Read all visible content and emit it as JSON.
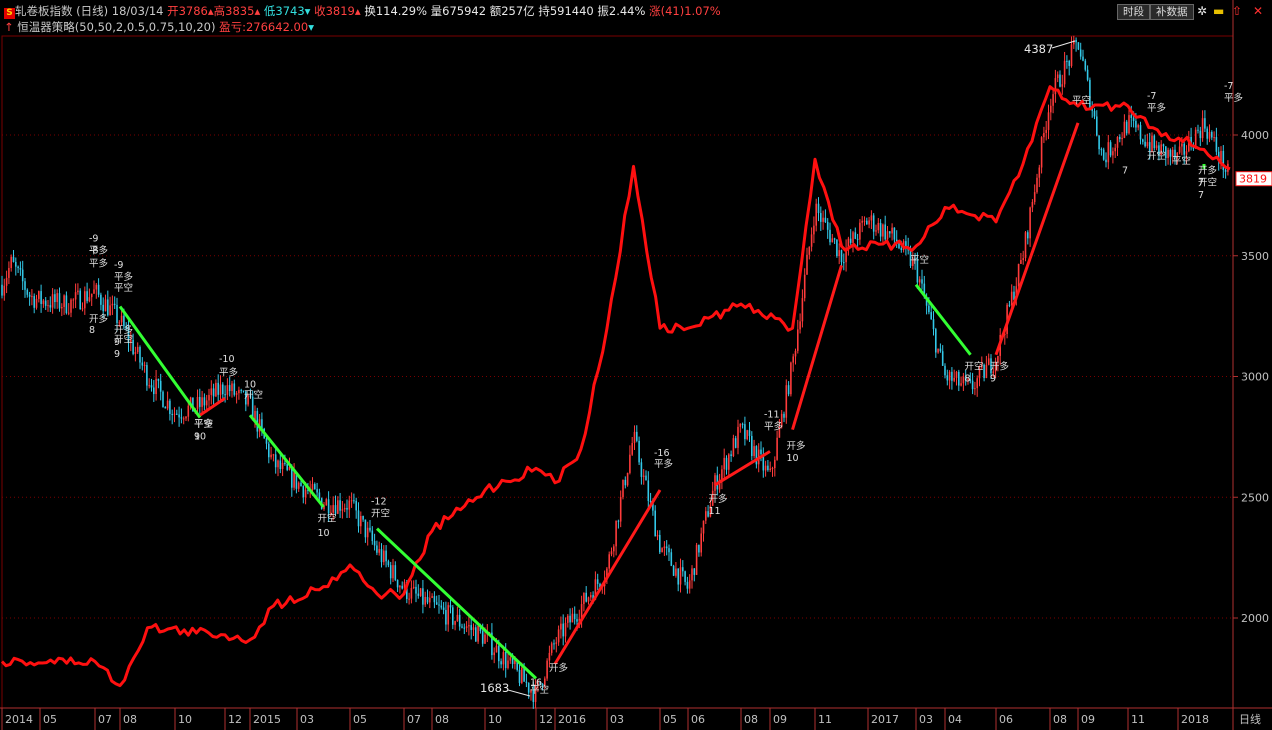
{
  "header": {
    "symbol_icon": "S",
    "name": "轧卷板指数",
    "period": "(日线)",
    "date": "18/03/14",
    "open_label": "开",
    "open_value": "3786",
    "high_label": "高",
    "high_value": "3835",
    "low_label": "低",
    "low_value": "3743",
    "close_label": "收",
    "close_value": "3819",
    "turnover_label": "换",
    "turnover_value": "114.29%",
    "volume_label": "量",
    "volume_value": "675942",
    "amount_label": "额",
    "amount_value": "257亿",
    "oi_label": "持",
    "oi_value": "591440",
    "amp_label": "振",
    "amp_value": "2.44%",
    "chg_label": "涨",
    "chg_value": "(41)1.07%"
  },
  "strategy": {
    "name": "恒温器策略",
    "params": "(50,50,2,0.5,0.75,10,20)",
    "pl_label": "盈亏:",
    "pl_value": "276642.00"
  },
  "toolbar": {
    "period_button": "时段",
    "data_button": "补数据",
    "icons": [
      "settings-icon",
      "lock-icon",
      "up-arrow-icon",
      "close-icon"
    ]
  },
  "colors": {
    "up_candle": "#ff3b3b",
    "down_candle": "#33c8e8",
    "equity_line": "#ff1010",
    "long_trade": "#ff1a1a",
    "short_trade": "#33ff33",
    "grid": "#7a0000",
    "axis_text": "#c0c0c0"
  },
  "chart_data": {
    "type": "line",
    "price_axis_ticks": [
      "4000",
      "3500",
      "3000",
      "2500",
      "2000"
    ],
    "time_axis_labels": [
      "2014",
      "05",
      "07",
      "08",
      "10",
      "12",
      "2015",
      "03",
      "05",
      "07",
      "08",
      "10",
      "12",
      "2016",
      "03",
      "05",
      "06",
      "08",
      "09",
      "11",
      "2017",
      "03",
      "04",
      "06",
      "08",
      "09",
      "11",
      "2018"
    ],
    "time_axis_unit": "日线",
    "last_price": "3819",
    "annotations": [
      {
        "label": "4387",
        "kind": "high"
      },
      {
        "label": "1683",
        "kind": "low"
      }
    ],
    "price_path": [
      {
        "date": "2014-01",
        "price": 3380
      },
      {
        "date": "2014-02",
        "price": 3470
      },
      {
        "date": "2014-04",
        "price": 3330
      },
      {
        "date": "2014-06",
        "price": 3300
      },
      {
        "date": "2014-07",
        "price": 3350
      },
      {
        "date": "2014-08",
        "price": 3230
      },
      {
        "date": "2014-09",
        "price": 3000
      },
      {
        "date": "2014-10",
        "price": 2850
      },
      {
        "date": "2014-11",
        "price": 2880
      },
      {
        "date": "2014-12",
        "price": 2960
      },
      {
        "date": "2015-01",
        "price": 2880
      },
      {
        "date": "2015-02",
        "price": 2640
      },
      {
        "date": "2015-03",
        "price": 2560
      },
      {
        "date": "2015-04",
        "price": 2480
      },
      {
        "date": "2015-05",
        "price": 2470
      },
      {
        "date": "2015-06",
        "price": 2280
      },
      {
        "date": "2015-07",
        "price": 2120
      },
      {
        "date": "2015-08",
        "price": 2050
      },
      {
        "date": "2015-10",
        "price": 1920
      },
      {
        "date": "2015-12",
        "price": 1683
      },
      {
        "date": "2016-01",
        "price": 1900
      },
      {
        "date": "2016-03",
        "price": 2200
      },
      {
        "date": "2016-04",
        "price": 2750
      },
      {
        "date": "2016-05",
        "price": 2300
      },
      {
        "date": "2016-06",
        "price": 2120
      },
      {
        "date": "2016-07",
        "price": 2550
      },
      {
        "date": "2016-08",
        "price": 2780
      },
      {
        "date": "2016-09",
        "price": 2580
      },
      {
        "date": "2016-10",
        "price": 3050
      },
      {
        "date": "2016-11",
        "price": 3700
      },
      {
        "date": "2016-12",
        "price": 3500
      },
      {
        "date": "2017-01",
        "price": 3650
      },
      {
        "date": "2017-02",
        "price": 3580
      },
      {
        "date": "2017-03",
        "price": 3450
      },
      {
        "date": "2017-04",
        "price": 3000
      },
      {
        "date": "2017-05",
        "price": 2950
      },
      {
        "date": "2017-06",
        "price": 3080
      },
      {
        "date": "2017-07",
        "price": 3500
      },
      {
        "date": "2017-08",
        "price": 4150
      },
      {
        "date": "2017-09",
        "price": 4387
      },
      {
        "date": "2017-10",
        "price": 3900
      },
      {
        "date": "2017-11",
        "price": 4050
      },
      {
        "date": "2017-12",
        "price": 3950
      },
      {
        "date": "2018-01",
        "price": 3900
      },
      {
        "date": "2018-02",
        "price": 4050
      },
      {
        "date": "2018-03",
        "price": 3819
      }
    ],
    "equity_curve_points": [
      {
        "date": "2014-01",
        "value": 1820
      },
      {
        "date": "2014-07",
        "value": 1820
      },
      {
        "date": "2014-08",
        "value": 1720
      },
      {
        "date": "2014-09",
        "value": 1960
      },
      {
        "date": "2014-12",
        "value": 1930
      },
      {
        "date": "2015-01",
        "value": 1910
      },
      {
        "date": "2015-02",
        "value": 2050
      },
      {
        "date": "2015-04",
        "value": 2130
      },
      {
        "date": "2015-05",
        "value": 2220
      },
      {
        "date": "2015-06",
        "value": 2100
      },
      {
        "date": "2015-07",
        "value": 2100
      },
      {
        "date": "2015-08",
        "value": 2360
      },
      {
        "date": "2015-10",
        "value": 2530
      },
      {
        "date": "2015-12",
        "value": 2620
      },
      {
        "date": "2016-01",
        "value": 2560
      },
      {
        "date": "2016-02",
        "value": 2700
      },
      {
        "date": "2016-03",
        "value": 3200
      },
      {
        "date": "2016-04",
        "value": 3870
      },
      {
        "date": "2016-05",
        "value": 3200
      },
      {
        "date": "2016-06",
        "value": 3200
      },
      {
        "date": "2016-08",
        "value": 3300
      },
      {
        "date": "2016-10",
        "value": 3200
      },
      {
        "date": "2016-11",
        "value": 3900
      },
      {
        "date": "2016-12",
        "value": 3540
      },
      {
        "date": "2017-03",
        "value": 3540
      },
      {
        "date": "2017-04",
        "value": 3700
      },
      {
        "date": "2017-06",
        "value": 3640
      },
      {
        "date": "2017-07",
        "value": 3880
      },
      {
        "date": "2017-08",
        "value": 4200
      },
      {
        "date": "2017-09",
        "value": 4120
      },
      {
        "date": "2017-11",
        "value": 4120
      },
      {
        "date": "2017-12",
        "value": 4030
      },
      {
        "date": "2018-02",
        "value": 3940
      },
      {
        "date": "2018-03",
        "value": 3860
      }
    ],
    "trade_lines": [
      {
        "side": "short",
        "from": {
          "date": "2014-08",
          "price": 3290
        },
        "to": {
          "date": "2014-11",
          "price": 2830
        }
      },
      {
        "side": "long",
        "from": {
          "date": "2014-11",
          "price": 2840
        },
        "to": {
          "date": "2014-12",
          "price": 2910
        }
      },
      {
        "side": "short",
        "from": {
          "date": "2015-01",
          "price": 2840
        },
        "to": {
          "date": "2015-04",
          "price": 2460
        }
      },
      {
        "side": "short",
        "from": {
          "date": "2015-06",
          "price": 2370
        },
        "to": {
          "date": "2015-12",
          "price": 1750
        }
      },
      {
        "side": "long",
        "from": {
          "date": "2016-01",
          "price": 1810
        },
        "to": {
          "date": "2016-05",
          "price": 2530
        }
      },
      {
        "side": "long",
        "from": {
          "date": "2016-07",
          "price": 2550
        },
        "to": {
          "date": "2016-09",
          "price": 2690
        }
      },
      {
        "side": "long",
        "from": {
          "date": "2016-10",
          "price": 2780
        },
        "to": {
          "date": "2016-12",
          "price": 3460
        }
      },
      {
        "side": "short",
        "from": {
          "date": "2017-03",
          "price": 3380
        },
        "to": {
          "date": "2017-05",
          "price": 3090
        }
      },
      {
        "side": "long",
        "from": {
          "date": "2017-06",
          "price": 3090
        },
        "to": {
          "date": "2017-09",
          "price": 4050
        }
      },
      {
        "side": "short",
        "from": {
          "date": "2018-02",
          "price": 3860
        },
        "to": {
          "date": "2018-02",
          "price": 3880
        }
      }
    ],
    "signal_labels": [
      {
        "text": "-8",
        "date": "2014-07",
        "price": 3510
      },
      {
        "text": "平多",
        "date": "2014-07",
        "price": 3455
      },
      {
        "text": "-9",
        "date": "2014-07",
        "price": 3560
      },
      {
        "text": "平多",
        "date": "2014-07",
        "price": 3510
      },
      {
        "text": "-9",
        "date": "2014-08",
        "price": 3450
      },
      {
        "text": "平多",
        "date": "2014-08",
        "price": 3400
      },
      {
        "text": "平空",
        "date": "2014-08",
        "price": 3355
      },
      {
        "text": "开多",
        "date": "2014-07",
        "price": 3225
      },
      {
        "text": "8",
        "date": "2014-07",
        "price": 3180
      },
      {
        "text": "开多",
        "date": "2014-08",
        "price": 3180
      },
      {
        "text": "9",
        "date": "2014-08",
        "price": 3130
      },
      {
        "text": "开空",
        "date": "2014-08",
        "price": 3140
      },
      {
        "text": "9",
        "date": "2014-08",
        "price": 3080
      },
      {
        "text": "-10",
        "date": "2014-12",
        "price": 3060
      },
      {
        "text": "平多",
        "date": "2014-12",
        "price": 3005
      },
      {
        "text": "10",
        "date": "2015-01",
        "price": 2955
      },
      {
        "text": "开空",
        "date": "2015-01",
        "price": 2910
      },
      {
        "text": "平空",
        "date": "2014-11",
        "price": 2790
      },
      {
        "text": "平多",
        "date": "2014-11",
        "price": 2790
      },
      {
        "text": "9",
        "date": "2014-11",
        "price": 2740
      },
      {
        "text": "10",
        "date": "2014-11",
        "price": 2740
      },
      {
        "text": "开空",
        "date": "2015-04",
        "price": 2400
      },
      {
        "text": "10",
        "date": "2015-04",
        "price": 2340
      },
      {
        "text": "-12",
        "date": "2015-06",
        "price": 2470
      },
      {
        "text": "开空",
        "date": "2015-06",
        "price": 2420
      },
      {
        "text": "开多",
        "date": "2016-01",
        "price": 1780
      },
      {
        "text": "平空",
        "date": "2015-12",
        "price": 1690
      },
      {
        "text": "16",
        "date": "2015-12",
        "price": 1720
      },
      {
        "text": "-16",
        "date": "2016-05",
        "price": 2670
      },
      {
        "text": "平多",
        "date": "2016-05",
        "price": 2625
      },
      {
        "text": "开多",
        "date": "2016-07",
        "price": 2480
      },
      {
        "text": "11",
        "date": "2016-07",
        "price": 2430
      },
      {
        "text": "-11",
        "date": "2016-09",
        "price": 2830
      },
      {
        "text": "平多",
        "date": "2016-09",
        "price": 2780
      },
      {
        "text": "开多",
        "date": "2016-10",
        "price": 2700
      },
      {
        "text": "10",
        "date": "2016-10",
        "price": 2650
      },
      {
        "text": "平空",
        "date": "2017-03",
        "price": 3470
      },
      {
        "text": "开空",
        "date": "2017-05",
        "price": 3030
      },
      {
        "text": "8",
        "date": "2017-05",
        "price": 2980
      },
      {
        "text": "开多",
        "date": "2017-06",
        "price": 3030
      },
      {
        "text": "9",
        "date": "2017-06",
        "price": 2980
      },
      {
        "text": "平空",
        "date": "2017-09",
        "price": 4130
      },
      {
        "text": "-7",
        "date": "2017-12",
        "price": 4150
      },
      {
        "text": "平多",
        "date": "2017-12",
        "price": 4100
      },
      {
        "text": "开空",
        "date": "2017-12",
        "price": 3900
      },
      {
        "text": "7",
        "date": "2017-11",
        "price": 3840
      },
      {
        "text": "平空",
        "date": "2018-01",
        "price": 3880
      },
      {
        "text": "开空",
        "date": "2018-02",
        "price": 3790
      },
      {
        "text": "7",
        "date": "2018-02",
        "price": 3740
      },
      {
        "text": "开多",
        "date": "2018-02",
        "price": 3840
      },
      {
        "text": "7",
        "date": "2018-02",
        "price": 3790
      },
      {
        "text": "-7",
        "date": "2018-03",
        "price": 4190
      },
      {
        "text": "平多",
        "date": "2018-03",
        "price": 4140
      }
    ]
  }
}
